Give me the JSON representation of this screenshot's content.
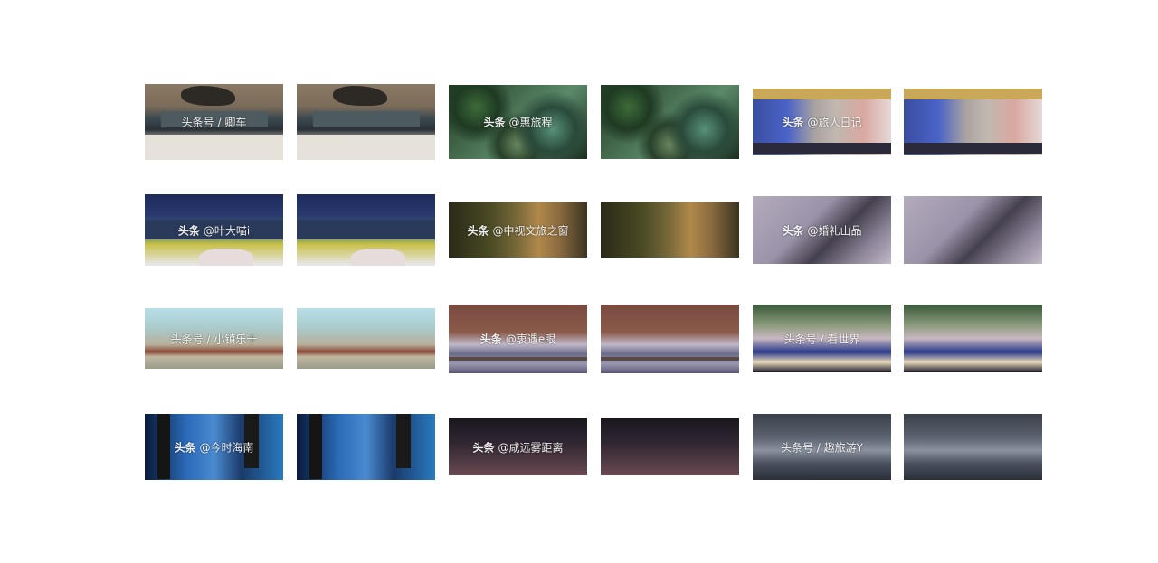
{
  "gallery": {
    "pairs": [
      {
        "watermark_prefix": "",
        "watermark_text": "头条号 / 卿车",
        "art": "a-statue"
      },
      {
        "watermark_prefix": "头条",
        "watermark_text": "@惠旅程",
        "art": "a-forest"
      },
      {
        "watermark_prefix": "头条",
        "watermark_text": "@旅人日记",
        "art": "a-window"
      },
      {
        "watermark_prefix": "头条",
        "watermark_text": "@叶大喵i",
        "art": "a-gate"
      },
      {
        "watermark_prefix": "头条",
        "watermark_text": "@中视文旅之窗",
        "art": "a-rock"
      },
      {
        "watermark_prefix": "头条",
        "watermark_text": "@婚礼山品",
        "art": "a-stone"
      },
      {
        "watermark_prefix": "",
        "watermark_text": "头条号 / 小镇乐十",
        "art": "a-wall"
      },
      {
        "watermark_prefix": "头条",
        "watermark_text": "@衷遇e眼",
        "art": "a-rail"
      },
      {
        "watermark_prefix": "",
        "watermark_text": "头条号 / 看世界",
        "art": "a-trees"
      },
      {
        "watermark_prefix": "头条",
        "watermark_text": "@今时海南",
        "art": "a-water"
      },
      {
        "watermark_prefix": "头条",
        "watermark_text": "@咸远雾距离",
        "art": "a-dusk"
      },
      {
        "watermark_prefix": "",
        "watermark_text": "头条号 / 趣旅游Y",
        "art": "a-blur"
      }
    ]
  }
}
